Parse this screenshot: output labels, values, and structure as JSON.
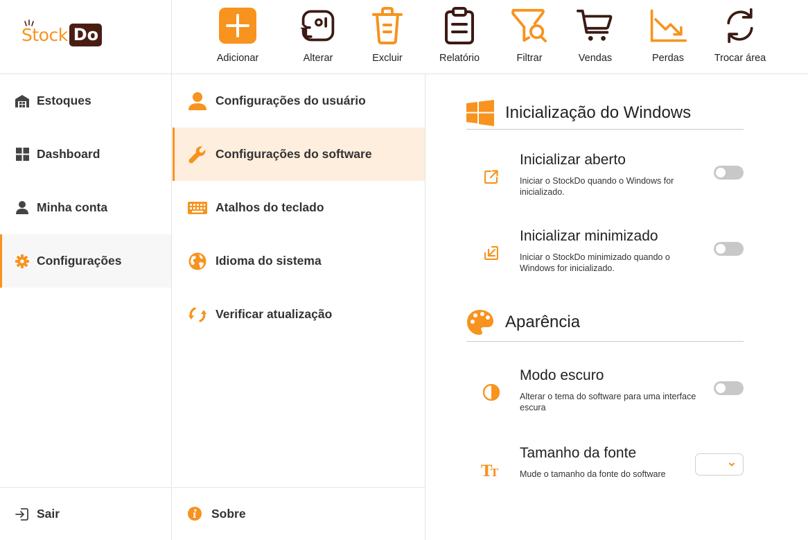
{
  "logo": {
    "part1": "Stock",
    "part2": "Do"
  },
  "toolbar": [
    {
      "label": "Adicionar",
      "icon": "add-square-icon"
    },
    {
      "label": "Alterar",
      "icon": "edit-swap-icon"
    },
    {
      "label": "Excluir",
      "icon": "trash-icon"
    },
    {
      "label": "Relatório",
      "icon": "clipboard-report-icon"
    },
    {
      "label": "Filtrar",
      "icon": "filter-search-icon"
    },
    {
      "label": "Vendas",
      "icon": "shopping-cart-icon"
    },
    {
      "label": "Perdas",
      "icon": "trend-down-icon"
    },
    {
      "label": "Trocar área",
      "icon": "refresh-icon"
    }
  ],
  "sidebar": {
    "items": [
      {
        "label": "Estoques",
        "icon": "warehouse-icon"
      },
      {
        "label": "Dashboard",
        "icon": "grid-icon"
      },
      {
        "label": "Minha conta",
        "icon": "user-icon"
      },
      {
        "label": "Configurações",
        "icon": "gear-icon",
        "active": true
      }
    ],
    "logout": {
      "label": "Sair",
      "icon": "logout-icon"
    }
  },
  "settings_menu": {
    "items": [
      {
        "label": "Configurações do usuário",
        "icon": "user-icon"
      },
      {
        "label": "Configurações do software",
        "icon": "wrench-icon",
        "active": true
      },
      {
        "label": "Atalhos do teclado",
        "icon": "keyboard-icon"
      },
      {
        "label": "Idioma do sistema",
        "icon": "globe-icon"
      },
      {
        "label": "Verificar atualização",
        "icon": "sync-icon"
      }
    ],
    "about": {
      "label": "Sobre",
      "icon": "info-icon"
    }
  },
  "content": {
    "sections": [
      {
        "title": "Inicialização do Windows",
        "icon": "windows-icon",
        "settings": [
          {
            "title": "Inicializar aberto",
            "description": "Iniciar o StockDo quando o Windows for inicializado.",
            "icon": "open-external-icon",
            "enabled": false
          },
          {
            "title": "Inicializar minimizado",
            "description": "Iniciar o StockDo minimizado quando o Windows for inicializado.",
            "icon": "minimize-arrow-icon",
            "enabled": false
          }
        ]
      },
      {
        "title": "Aparência",
        "icon": "palette-icon",
        "settings": [
          {
            "title": "Modo escuro",
            "description": "Alterar o tema do software para uma interface escura",
            "icon": "contrast-icon",
            "enabled": false
          },
          {
            "title": "Tamanho da fonte",
            "description": "Mude o tamanho da fonte do software",
            "icon": "font-size-icon",
            "value": ""
          }
        ]
      }
    ]
  },
  "colors": {
    "accent": "#f7931e",
    "brand_dark": "#4a1d14",
    "active_menu_bg": "#fdeedd",
    "toggle_off": "#c8c8c8"
  }
}
